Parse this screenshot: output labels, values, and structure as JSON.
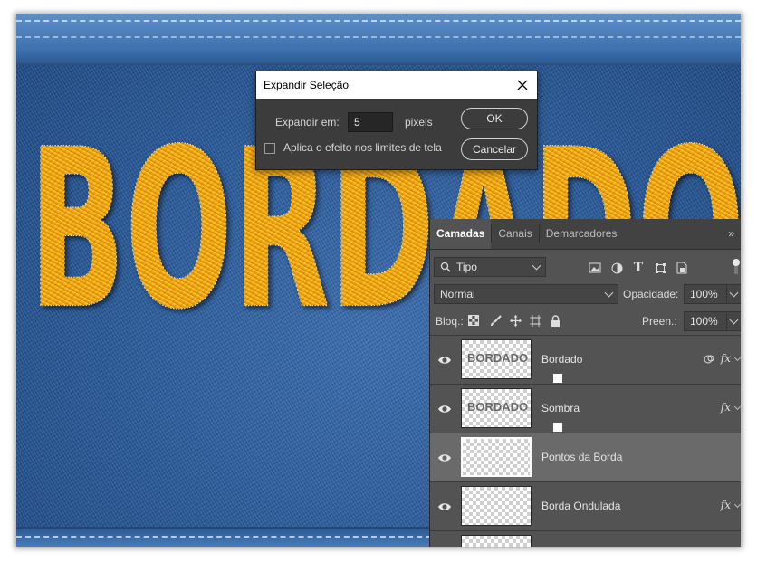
{
  "dialog": {
    "title": "Expandir Seleção",
    "expand_label": "Expandir em:",
    "expand_value": "5",
    "unit": "pixels",
    "checkbox_label": "Aplica o efeito nos limites de tela",
    "checkbox_checked": false,
    "ok_label": "OK",
    "cancel_label": "Cancelar"
  },
  "canvas": {
    "text": "BORDADO",
    "text_color": "#f4a90d",
    "fabric_color": "#2f5f9a"
  },
  "panel": {
    "tabs": [
      {
        "label": "Camadas",
        "active": true
      },
      {
        "label": "Canais",
        "active": false
      },
      {
        "label": "Demarcadores",
        "active": false
      }
    ],
    "filter_value": "Tipo",
    "blend_mode": "Normal",
    "opacity_label": "Opacidade:",
    "opacity_value": "100%",
    "lock_label": "Bloq.:",
    "fill_label": "Preen.:",
    "fill_value": "100%",
    "layers": [
      {
        "name": "Bordado",
        "thumb_text": "BORDADO",
        "fx": "fx",
        "selected": false
      },
      {
        "name": "Sombra",
        "thumb_text": "BORDADO",
        "fx": "fx",
        "selected": false
      },
      {
        "name": "Pontos da Borda",
        "thumb_text": "",
        "fx": "",
        "selected": true
      },
      {
        "name": "Borda Ondulada",
        "thumb_text": "",
        "fx": "fx",
        "selected": false
      }
    ]
  }
}
